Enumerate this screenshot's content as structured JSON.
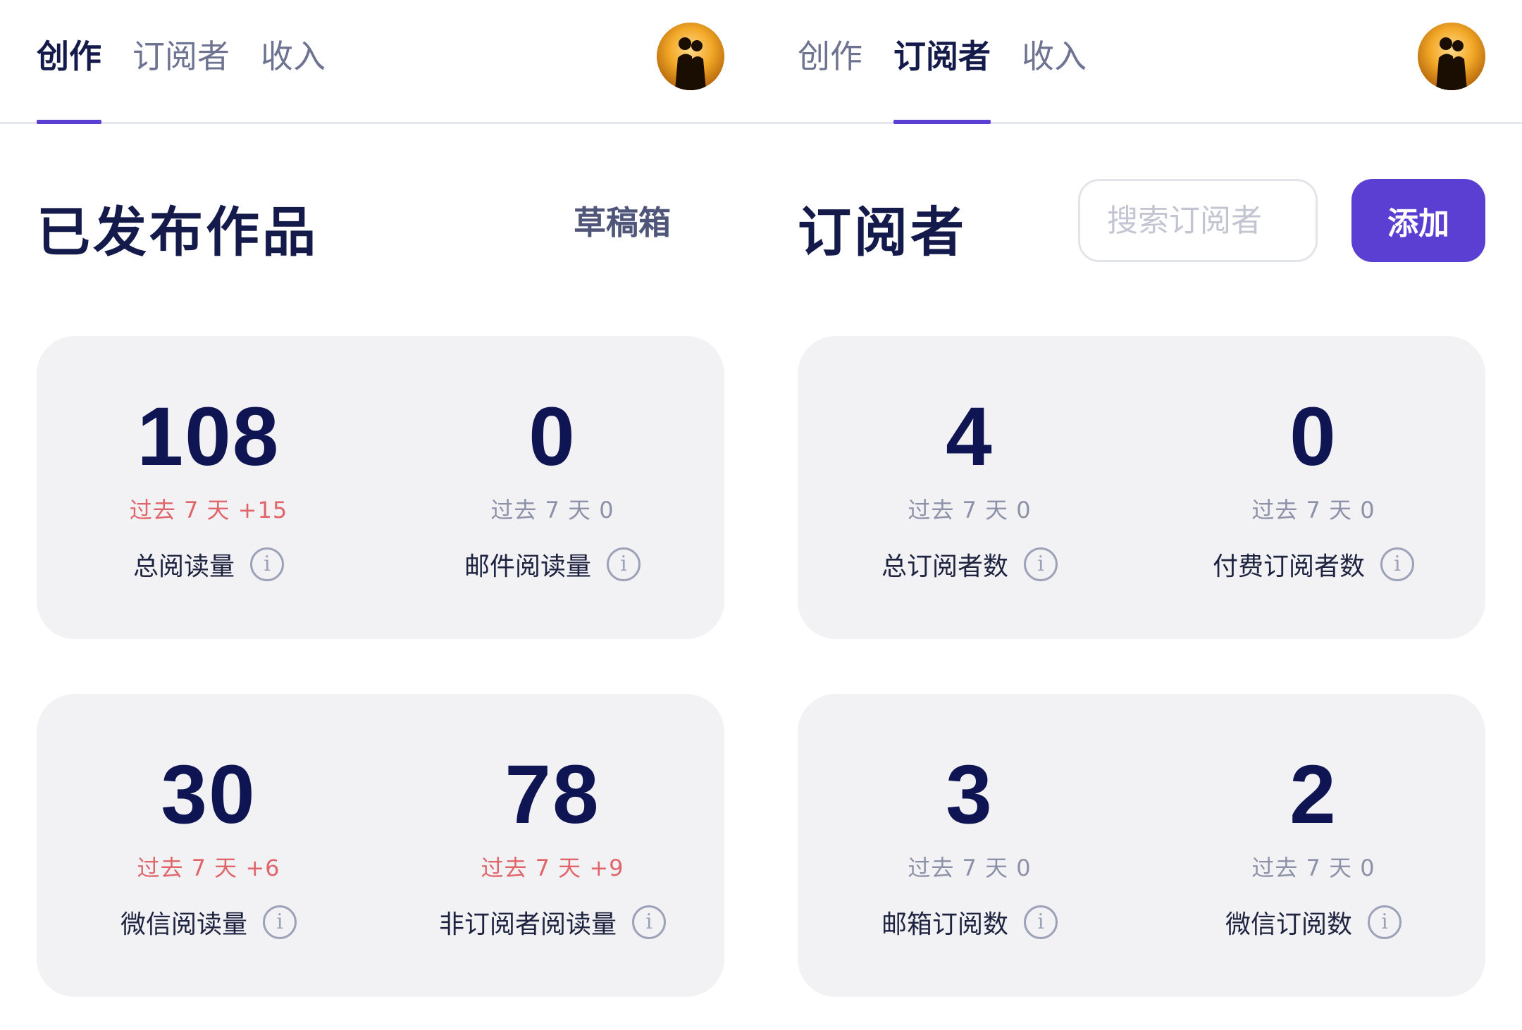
{
  "left": {
    "tabs": [
      {
        "label": "创作",
        "active": true
      },
      {
        "label": "订阅者",
        "active": false
      },
      {
        "label": "收入",
        "active": false
      }
    ],
    "title": "已发布作品",
    "drafts_label": "草稿箱",
    "stats": [
      {
        "value": "108",
        "delta": "过去 7 天 +15",
        "label": "总阅读量",
        "positive": true
      },
      {
        "value": "0",
        "delta": "过去 7 天 0",
        "label": "邮件阅读量",
        "positive": false
      },
      {
        "value": "30",
        "delta": "过去 7 天 +6",
        "label": "微信阅读量",
        "positive": true
      },
      {
        "value": "78",
        "delta": "过去 7 天 +9",
        "label": "非订阅者阅读量",
        "positive": true
      }
    ]
  },
  "right": {
    "tabs": [
      {
        "label": "创作",
        "active": false
      },
      {
        "label": "订阅者",
        "active": true
      },
      {
        "label": "收入",
        "active": false
      }
    ],
    "title": "订阅者",
    "search_placeholder": "搜索订阅者",
    "add_label": "添加",
    "stats": [
      {
        "value": "4",
        "delta": "过去 7 天 0",
        "label": "总订阅者数",
        "positive": false
      },
      {
        "value": "0",
        "delta": "过去 7 天 0",
        "label": "付费订阅者数",
        "positive": false
      },
      {
        "value": "3",
        "delta": "过去 7 天 0",
        "label": "邮箱订阅数",
        "positive": false
      },
      {
        "value": "2",
        "delta": "过去 7 天 0",
        "label": "微信订阅数",
        "positive": false
      }
    ]
  },
  "colors": {
    "accent": "#5b3fd3",
    "positive_delta": "#e0656b",
    "neutral_delta": "#8c91a8",
    "card_bg": "#f2f2f5",
    "text_dark": "#141a4a"
  },
  "icons": {
    "info": "info-icon",
    "avatar": "avatar-silhouette"
  },
  "info_glyph": "i"
}
